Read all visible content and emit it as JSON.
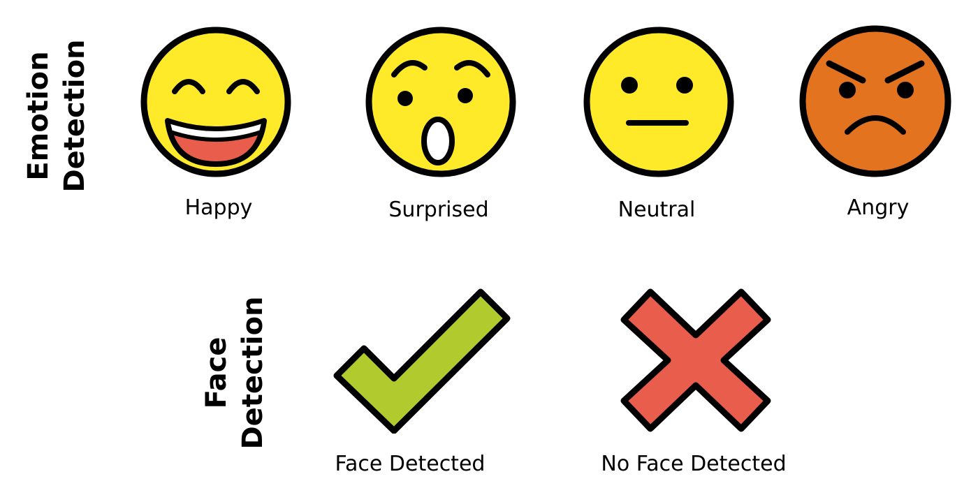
{
  "sections": {
    "emotion_detection": {
      "title_line1": "Emotion",
      "title_line2": "Detection",
      "emotions": [
        {
          "label": "Happy",
          "icon": "happy-face-icon",
          "color": "#FFEA2A"
        },
        {
          "label": "Surprised",
          "icon": "surprised-face-icon",
          "color": "#FFEA2A"
        },
        {
          "label": "Neutral",
          "icon": "neutral-face-icon",
          "color": "#FFEA2A"
        },
        {
          "label": "Angry",
          "icon": "angry-face-icon",
          "color": "#E3731E"
        }
      ]
    },
    "face_detection": {
      "title_line1": "Face",
      "title_line2": "Detection",
      "states": [
        {
          "label": "Face Detected",
          "icon": "checkmark-icon",
          "color": "#B1CB2E"
        },
        {
          "label": "No Face Detected",
          "icon": "cross-icon",
          "color": "#E85D4B"
        }
      ]
    }
  },
  "colors": {
    "outline": "#000000",
    "mouth_red": "#E85D4B",
    "teeth": "#FFFFFF"
  }
}
